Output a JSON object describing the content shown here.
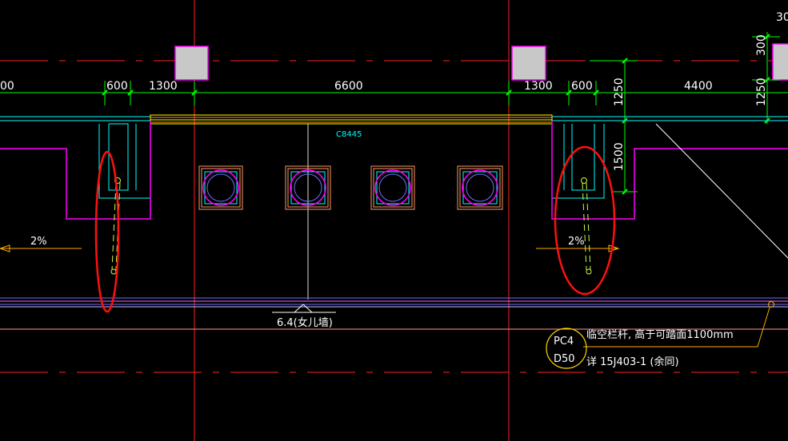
{
  "dimensions": {
    "d_left_edge": "00",
    "d600_left": "600",
    "d1300_left": "1300",
    "d6600": "6600",
    "d1300_right": "1300",
    "d600_right": "600",
    "d4400": "4400",
    "v1250_a": "1250",
    "v1500": "1500",
    "v300": "300",
    "v1250_b": "1250",
    "top_right": "30"
  },
  "labels": {
    "window_tag": "C8445",
    "slope_left": "2%",
    "slope_right": "2%",
    "parapet_elevation": "6.4(女儿墙)"
  },
  "callout": {
    "code_top": "PC4",
    "code_bottom": "D50",
    "note_line1": "临空栏杆, 高于可踏面1100mm",
    "note_line2": "详 15J403-1 (余同)"
  },
  "colors": {
    "background": "#000000",
    "axis_red": "#ff2020",
    "dim_green": "#00ff00",
    "cyan": "#00ffff",
    "magenta": "#ff00ff",
    "yellow": "#ffff00",
    "column_fill": "#c8c8c8",
    "slab_blue": "#7070ff",
    "highlight_red": "#ff1010"
  }
}
